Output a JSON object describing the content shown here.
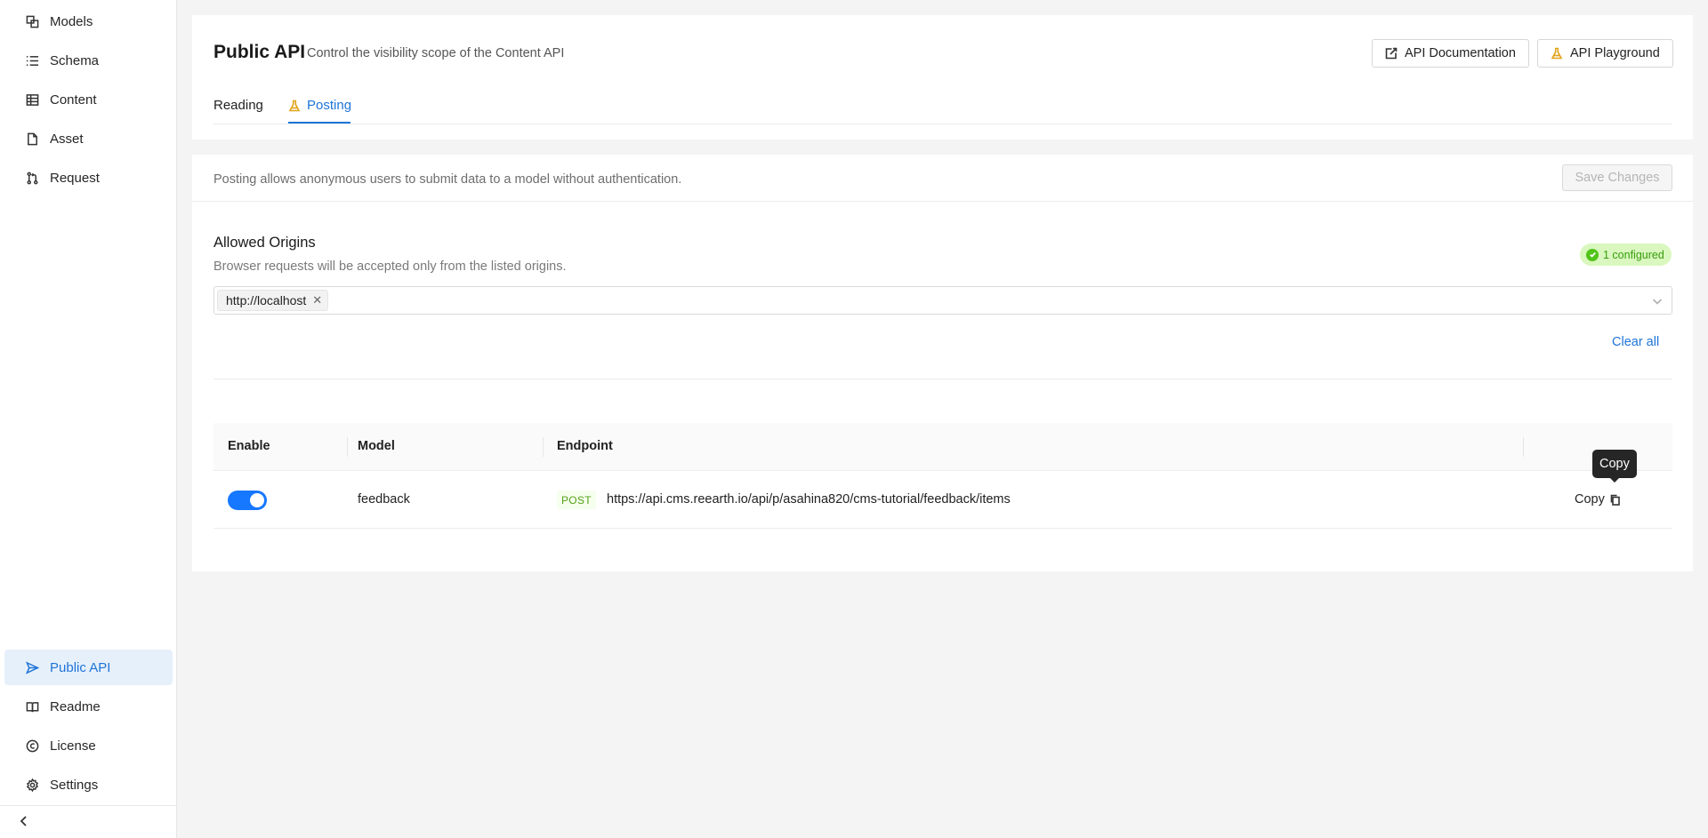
{
  "sidebar": {
    "top_items": [
      {
        "label": "Models",
        "icon": "models-icon"
      },
      {
        "label": "Schema",
        "icon": "schema-icon"
      },
      {
        "label": "Content",
        "icon": "table-icon"
      },
      {
        "label": "Asset",
        "icon": "file-icon"
      },
      {
        "label": "Request",
        "icon": "pull-request-icon"
      }
    ],
    "bottom_items": [
      {
        "label": "Public API",
        "icon": "send-icon",
        "active": true
      },
      {
        "label": "Readme",
        "icon": "book-icon"
      },
      {
        "label": "License",
        "icon": "copyright-icon"
      },
      {
        "label": "Settings",
        "icon": "gear-icon"
      }
    ],
    "collapse_icon": "chevron-left-icon"
  },
  "header": {
    "title": "Public API",
    "subtitle": "Control the visibility scope of the Content API",
    "doc_button": "API Documentation",
    "playground_button": "API Playground",
    "tabs": [
      {
        "label": "Reading",
        "active": false
      },
      {
        "label": "Posting",
        "active": true,
        "icon": "flask-icon"
      }
    ]
  },
  "posting": {
    "description": "Posting allows anonymous users to submit data to a model without authentication.",
    "save_button": "Save Changes",
    "origins": {
      "title": "Allowed Origins",
      "description": "Browser requests will be accepted only from the listed origins.",
      "badge": "1 configured",
      "tags": [
        "http://localhost"
      ],
      "clear_all": "Clear all"
    },
    "table": {
      "columns": [
        "Enable",
        "Model",
        "Endpoint"
      ],
      "rows": [
        {
          "enabled": true,
          "model": "feedback",
          "method": "POST",
          "endpoint": "https://api.cms.reearth.io/api/p/asahina820/cms-tutorial/feedback/items",
          "copy": "Copy"
        }
      ]
    },
    "tooltip": "Copy"
  },
  "colors": {
    "accent": "#1e74d8",
    "toggle_on": "#1677ff",
    "badge_bg": "#d9f7be",
    "badge_text": "#389e0d",
    "method_text": "#52a11a"
  }
}
